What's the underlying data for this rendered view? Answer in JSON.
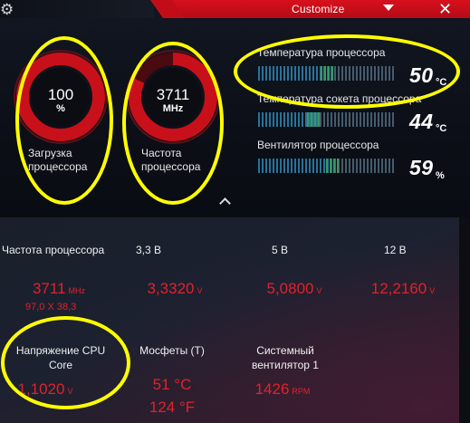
{
  "header": {
    "customize_label": "Customize",
    "accent_color": "#d8101d"
  },
  "gauges": [
    {
      "value": "100",
      "unit": "%",
      "label": "Загрузка\nпроцессора",
      "fill_fraction": 1.0
    },
    {
      "value": "3711",
      "unit": "MHz",
      "label": "Частота\nпроцессора",
      "fill_fraction": 0.82
    }
  ],
  "sensors": [
    {
      "name": "Температура процессора",
      "value": "50",
      "unit": "°C",
      "level": 0.55
    },
    {
      "name": "Температура сокета процессора",
      "value": "44",
      "unit": "°C",
      "level": 0.45
    },
    {
      "name": "Вентилятор процессора",
      "value": "59",
      "unit": "%",
      "level": 0.59
    }
  ],
  "grid": {
    "row1": [
      {
        "title": "Частота процессора",
        "value": "3711",
        "unit": "MHz",
        "sub": "97,0 X 38,3"
      },
      {
        "title": "3,3 В",
        "value": "3,3320",
        "unit": "V"
      },
      {
        "title": "5 В",
        "value": "5,0800",
        "unit": "V"
      },
      {
        "title": "12 В",
        "value": "12,2160",
        "unit": "V"
      }
    ],
    "row2": [
      {
        "title": "Напряжение CPU\nCore",
        "value": "1,1020",
        "unit": "V"
      },
      {
        "title": "Мосфеты (T)",
        "value": "51 °C",
        "value2": "124 °F"
      },
      {
        "title": "Системный\nвентилятор 1",
        "value": "1426",
        "unit": "RPM"
      }
    ]
  },
  "icons": {
    "gear": "gear-icon",
    "dropdown": "chevron-down-icon",
    "close": "close-icon",
    "collapse": "chevron-up-icon"
  },
  "colors": {
    "value_red": "#e0222c",
    "annotation_yellow": "#ffff00",
    "gauge_red": "#c8101a"
  }
}
